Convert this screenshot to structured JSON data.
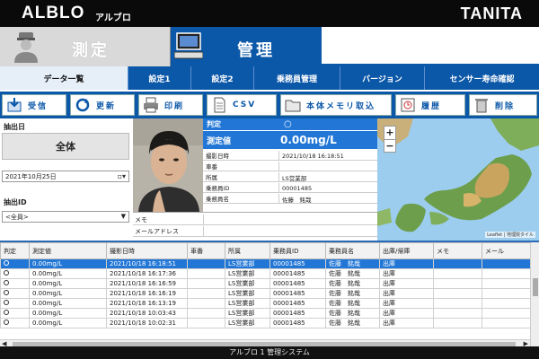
{
  "app": {
    "logo": "ALBLO",
    "logo_kana": "アルブロ",
    "brand": "TANITA"
  },
  "modes": {
    "measure": "測定",
    "manage": "管理"
  },
  "menu": [
    {
      "label": "データ一覧",
      "active": true
    },
    {
      "label": "設定1"
    },
    {
      "label": "設定2"
    },
    {
      "label": "乗務員管理"
    },
    {
      "label": "バージョン"
    },
    {
      "label": "センサー寿命確認"
    }
  ],
  "toolbar": {
    "receive": "受信",
    "update": "更新",
    "print": "印刷",
    "csv": "CSV",
    "memory": "本体メモリ取込",
    "history": "履歴",
    "delete": "削除"
  },
  "left": {
    "date_label": "抽出日",
    "all_button": "全体",
    "date_value": "2021年10月25日",
    "id_label": "抽出ID",
    "id_value": "<全員>"
  },
  "detail": {
    "judge_label": "判定",
    "judge_value": "○",
    "value_label": "測定値",
    "value_value": "0.00mg/L",
    "rows": [
      {
        "label": "撮影日時",
        "value": "2021/10/18 16:18:51"
      },
      {
        "label": "車番",
        "value": ""
      },
      {
        "label": "所属",
        "value": "LS営業部"
      },
      {
        "label": "乗務員ID",
        "value": "00001485"
      },
      {
        "label": "乗務員名",
        "value": "佐藤　銘哉"
      }
    ]
  },
  "memo": {
    "memo_label": "メモ",
    "email_label": "メールアドレス"
  },
  "map": {
    "credit": "Leaflet | 地理院タイル"
  },
  "table": {
    "headers": [
      "判定",
      "測定値",
      "撮影日時",
      "車番",
      "所属",
      "乗務員ID",
      "乗務員名",
      "出庫/帰庫",
      "メモ",
      "メール"
    ],
    "rows": [
      [
        "○",
        "0.00mg/L",
        "2021/10/18 16:18:51",
        "",
        "LS営業部",
        "00001485",
        "佐藤　銘哉",
        "出庫",
        "",
        ""
      ],
      [
        "○",
        "0.00mg/L",
        "2021/10/18 16:17:36",
        "",
        "LS営業部",
        "00001485",
        "佐藤　銘哉",
        "出庫",
        "",
        ""
      ],
      [
        "○",
        "0.00mg/L",
        "2021/10/18 16:16:59",
        "",
        "LS営業部",
        "00001485",
        "佐藤　銘哉",
        "出庫",
        "",
        ""
      ],
      [
        "○",
        "0.00mg/L",
        "2021/10/18 16:16:19",
        "",
        "LS営業部",
        "00001485",
        "佐藤　銘哉",
        "出庫",
        "",
        ""
      ],
      [
        "○",
        "0.00mg/L",
        "2021/10/18 16:13:19",
        "",
        "LS営業部",
        "00001485",
        "佐藤　銘哉",
        "出庫",
        "",
        ""
      ],
      [
        "○",
        "0.00mg/L",
        "2021/10/18 10:03:43",
        "",
        "LS営業部",
        "00001485",
        "佐藤　銘哉",
        "出庫",
        "",
        ""
      ],
      [
        "○",
        "0.00mg/L",
        "2021/10/18 10:02:31",
        "",
        "LS営業部",
        "00001485",
        "佐藤　銘哉",
        "出庫",
        "",
        ""
      ]
    ],
    "selected": 0
  },
  "footer": "アルブロ 1 管理システム",
  "colors": {
    "primary": "#0b57a8",
    "selected": "#2277d6"
  }
}
